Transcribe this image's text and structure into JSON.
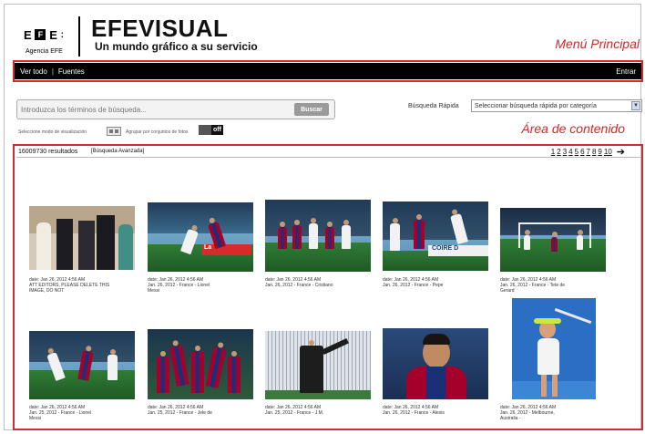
{
  "header": {
    "logo_text": "EFE",
    "agency": "Agencia EFE",
    "brand": "EFEVISUAL",
    "tagline": "Un mundo gráfico a su servicio"
  },
  "annotations": {
    "menu": "Menú Principal",
    "content": "Área de contenido",
    "color": "#d42c2c"
  },
  "menu": {
    "items": [
      "Ver todo",
      "Fuentes"
    ],
    "separator": "|",
    "login": "Entrar"
  },
  "search": {
    "placeholder": "Introduzca los términos de búsqueda...",
    "button": "Buscar",
    "quick_label": "Búsqueda Rápida",
    "quick_value": "Seleccionar búsqueda rápida por categoría",
    "view_mode_label": "Seleccione modo de visualización",
    "group_label": "Agrupar por conjuntos de fotos",
    "toggle_off": "off"
  },
  "results": {
    "count": "16009730 resultados",
    "advanced": "[Búsqueda Avanzada]",
    "pages": [
      "1",
      "2",
      "3",
      "4",
      "5",
      "6",
      "7",
      "8",
      "9",
      "10"
    ],
    "next_arrow": "➔",
    "items": [
      {
        "caption": "date: Jan 26, 2012 4:56 AM\nATT EDITORS, PLEASE DELETE THIS\nIMAGE, DO NOT",
        "icon": "royal-family-photo"
      },
      {
        "caption": "date: Jan 26, 2012 4:56 AM\nJan. 26, 2012 - France - Lionel\nMessi",
        "icon": "soccer-match-photo"
      },
      {
        "caption": "date: Jan 26, 2012 4:56 AM\nJan. 26, 2012 - France - Cristiano",
        "icon": "soccer-match-photo"
      },
      {
        "caption": "date: Jan 26, 2012 4:56 AM\nJan. 26, 2012 - France - Pepe",
        "icon": "soccer-match-photo"
      },
      {
        "caption": "date: Jan 26, 2012 4:56 AM\nJan. 26, 2012 - France - Tete de\nGerard",
        "icon": "soccer-match-photo"
      },
      {
        "caption": "date: Jan 26, 2012 4:56 AM\nJan. 25, 2012 - France - Lionel\nMessi",
        "icon": "soccer-match-photo"
      },
      {
        "caption": "date: Jan 26, 2012 4:56 AM\nJan. 25, 2012 - France - Jele de",
        "icon": "soccer-celebration-photo"
      },
      {
        "caption": "date: Jan 26, 2012 4:56 AM\nJan. 25, 2012 - France - J.M.",
        "icon": "goalkeeper-photo"
      },
      {
        "caption": "date: Jan 26, 2012 4:56 AM\nJan. 26, 2012 - France - Alexis",
        "icon": "player-portrait-photo"
      },
      {
        "caption": "date: Jan 26, 2012 4:56 AM\nJan. 26, 2012 - Melbourne,\nAustralia -",
        "icon": "tennis-player-photo"
      }
    ]
  }
}
